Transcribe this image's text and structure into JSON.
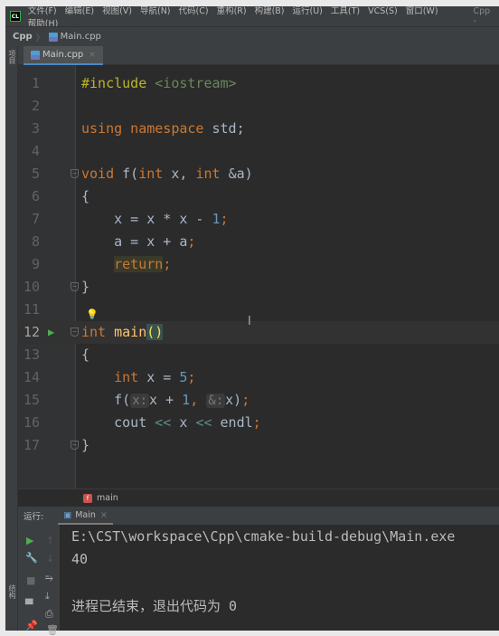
{
  "menu": {
    "logo": "CL",
    "items": [
      "文件(F)",
      "编辑(E)",
      "视图(V)",
      "导航(N)",
      "代码(C)",
      "重构(R)",
      "构建(B)",
      "运行(U)",
      "工具(T)",
      "VCS(S)",
      "窗口(W)",
      "帮助(H)"
    ],
    "project": "Cpp -"
  },
  "breadcrumb": {
    "project": "Cpp",
    "file": "Main.cpp"
  },
  "sidebar": {
    "project_label": "项目",
    "structure_label": "结构"
  },
  "tab": {
    "label": "Main.cpp",
    "close": "×"
  },
  "editor": {
    "lines": [
      {
        "n": "1",
        "tokens": [
          [
            "#include <iostream>",
            "str0"
          ]
        ]
      },
      {
        "n": "2",
        "tokens": []
      },
      {
        "n": "3",
        "tokens": [
          [
            "using namespace",
            "kw"
          ],
          [
            " std;",
            ""
          ]
        ]
      },
      {
        "n": "4",
        "tokens": []
      },
      {
        "n": "5",
        "tokens": [
          [
            "void ",
            "kw"
          ],
          [
            "f(",
            ""
          ],
          [
            "int ",
            "kw"
          ],
          [
            "x, ",
            ""
          ],
          [
            "int ",
            "kw"
          ],
          [
            "&a)",
            ""
          ]
        ]
      },
      {
        "n": "6",
        "tokens": [
          [
            "{",
            ""
          ]
        ]
      },
      {
        "n": "7",
        "tokens": [
          [
            "    x = x * x - ",
            ""
          ],
          [
            "1",
            "num"
          ],
          [
            ";",
            "kw"
          ]
        ]
      },
      {
        "n": "8",
        "tokens": [
          [
            "    a = x + a",
            ""
          ],
          [
            ";",
            "kw"
          ]
        ]
      },
      {
        "n": "9",
        "tokens": [
          [
            "    ",
            ""
          ],
          [
            "return",
            "ret"
          ],
          [
            ";",
            "kw"
          ]
        ]
      },
      {
        "n": "10",
        "tokens": [
          [
            "}",
            ""
          ]
        ]
      },
      {
        "n": "11",
        "tokens": []
      },
      {
        "n": "12",
        "tokens": [
          [
            "int ",
            "kw"
          ],
          [
            "main",
            "fn"
          ],
          [
            "()",
            "pm"
          ]
        ]
      },
      {
        "n": "13",
        "tokens": [
          [
            "{",
            ""
          ]
        ]
      },
      {
        "n": "14",
        "tokens": [
          [
            "    ",
            ""
          ],
          [
            "int ",
            "kw"
          ],
          [
            "x = ",
            ""
          ],
          [
            "5",
            "num"
          ],
          [
            ";",
            "kw"
          ]
        ]
      },
      {
        "n": "15",
        "tokens": [
          [
            "    f(",
            ""
          ],
          [
            "x:",
            "hint"
          ],
          [
            "x + ",
            ""
          ],
          [
            "1",
            "num"
          ],
          [
            ", ",
            "kw"
          ],
          [
            "&:",
            "hint"
          ],
          [
            "x)",
            ""
          ],
          [
            ";",
            "kw"
          ]
        ]
      },
      {
        "n": "16",
        "tokens": [
          [
            "    cout ",
            ""
          ],
          [
            "<<",
            "op"
          ],
          [
            " x ",
            ""
          ],
          [
            "<<",
            "op"
          ],
          [
            " endl",
            ""
          ],
          [
            ";",
            "kw"
          ]
        ]
      },
      {
        "n": "17",
        "tokens": [
          [
            "}",
            ""
          ]
        ]
      }
    ],
    "current_line": "12",
    "run_line": "12",
    "fold_lines": [
      "5",
      "10",
      "12",
      "17"
    ]
  },
  "context": {
    "badge": "f",
    "function": "main"
  },
  "run": {
    "label": "运行:",
    "tab": "Main",
    "close": "×"
  },
  "console": {
    "lines": [
      "E:\\CST\\workspace\\Cpp\\cmake-build-debug\\Main.exe",
      "40",
      "",
      "进程已结束，退出代码为 0"
    ]
  }
}
